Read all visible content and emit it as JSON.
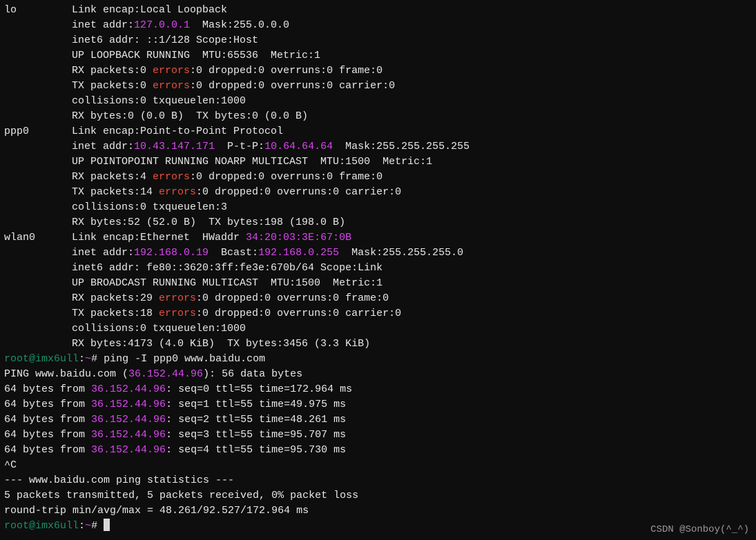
{
  "ifaces": {
    "lo": {
      "name": "lo",
      "encap": "Local Loopback",
      "inet_addr": "127.0.0.1",
      "mask": "255.0.0.0",
      "inet6": "::1/128",
      "scope": "Host",
      "flags": "UP LOOPBACK RUNNING",
      "mtu": "65536",
      "metric": "1",
      "rx_packets": "0",
      "rx_errors": "0",
      "rx_dropped": "0",
      "rx_overruns": "0",
      "rx_frame": "0",
      "tx_packets": "0",
      "tx_errors": "0",
      "tx_dropped": "0",
      "tx_overruns": "0",
      "tx_carrier": "0",
      "collisions": "0",
      "txqueuelen": "1000",
      "rx_bytes": "0",
      "rx_bytes_h": "0.0 B",
      "tx_bytes": "0",
      "tx_bytes_h": "0.0 B"
    },
    "ppp0": {
      "name": "ppp0",
      "encap": "Point-to-Point Protocol",
      "inet_addr": "10.43.147.171",
      "ptp": "10.64.64.64",
      "mask": "255.255.255.255",
      "flags": "UP POINTOPOINT RUNNING NOARP MULTICAST",
      "mtu": "1500",
      "metric": "1",
      "rx_packets": "4",
      "rx_errors": "0",
      "rx_dropped": "0",
      "rx_overruns": "0",
      "rx_frame": "0",
      "tx_packets": "14",
      "tx_errors": "0",
      "tx_dropped": "0",
      "tx_overruns": "0",
      "tx_carrier": "0",
      "collisions": "0",
      "txqueuelen": "3",
      "rx_bytes": "52",
      "rx_bytes_h": "52.0 B",
      "tx_bytes": "198",
      "tx_bytes_h": "198.0 B"
    },
    "wlan0": {
      "name": "wlan0",
      "encap": "Ethernet",
      "hwaddr": "34:20:03:3E:67:0B",
      "inet_addr": "192.168.0.19",
      "bcast": "192.168.0.255",
      "mask": "255.255.255.0",
      "inet6": "fe80::3620:3ff:fe3e:670b/64",
      "scope": "Link",
      "flags": "UP BROADCAST RUNNING MULTICAST",
      "mtu": "1500",
      "metric": "1",
      "rx_packets": "29",
      "rx_errors": "0",
      "rx_dropped": "0",
      "rx_overruns": "0",
      "rx_frame": "0",
      "tx_packets": "18",
      "tx_errors": "0",
      "tx_dropped": "0",
      "tx_overruns": "0",
      "tx_carrier": "0",
      "collisions": "0",
      "txqueuelen": "1000",
      "rx_bytes": "4173",
      "rx_bytes_h": "4.0 KiB",
      "tx_bytes": "3456",
      "tx_bytes_h": "3.3 KiB"
    }
  },
  "prompt": {
    "user_host": "root@imx6ull",
    "sep": ":",
    "path": "~",
    "symbol": "# "
  },
  "ping": {
    "cmd": "ping -I ppp0 www.baidu.com",
    "host": "www.baidu.com",
    "ip": "36.152.44.96",
    "data_bytes": "56",
    "replies": [
      {
        "bytes": "64",
        "ip": "36.152.44.96",
        "seq": "0",
        "ttl": "55",
        "time": "172.964"
      },
      {
        "bytes": "64",
        "ip": "36.152.44.96",
        "seq": "1",
        "ttl": "55",
        "time": "49.975"
      },
      {
        "bytes": "64",
        "ip": "36.152.44.96",
        "seq": "2",
        "ttl": "55",
        "time": "48.261"
      },
      {
        "bytes": "64",
        "ip": "36.152.44.96",
        "seq": "3",
        "ttl": "55",
        "time": "95.707"
      },
      {
        "bytes": "64",
        "ip": "36.152.44.96",
        "seq": "4",
        "ttl": "55",
        "time": "95.730"
      }
    ],
    "interrupt": "^C",
    "stats_header": "--- www.baidu.com ping statistics ---",
    "stats_line": "5 packets transmitted, 5 packets received, 0% packet loss",
    "rtt_line": "round-trip min/avg/max = 48.261/92.527/172.964 ms"
  },
  "watermark": "CSDN @Sonboy(^_^)"
}
